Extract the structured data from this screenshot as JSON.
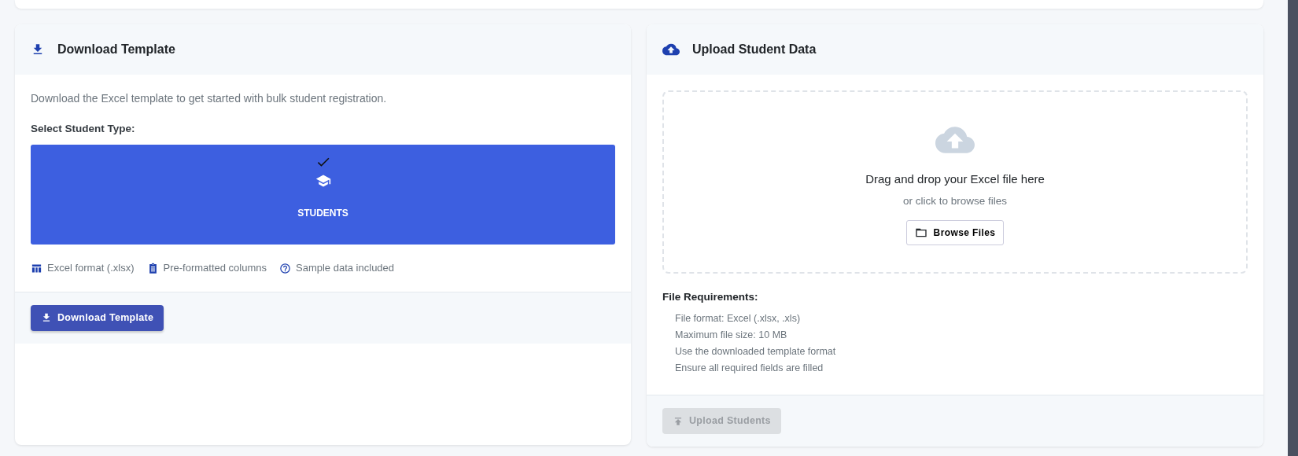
{
  "download_card": {
    "title": "Download Template",
    "description": "Download the Excel template to get started with bulk student registration.",
    "type_label": "Select Student Type:",
    "student_types": [
      {
        "label": "STUDENTS",
        "selected": true
      }
    ],
    "features": [
      {
        "kind": "table",
        "label": "Excel format (.xlsx)"
      },
      {
        "kind": "clipboard",
        "label": "Pre-formatted columns"
      },
      {
        "kind": "help",
        "label": "Sample data included"
      }
    ],
    "button": {
      "label": "Download Template",
      "disabled": false
    }
  },
  "upload_card": {
    "title": "Upload Student Data",
    "drop_title": "Drag and drop your Excel file here",
    "drop_hint": "or click to browse files",
    "browse_button": "Browse Files",
    "requirements_title": "File Requirements:",
    "requirements": [
      "File format: Excel (.xlsx, .xls)",
      "Maximum file size: 10 MB",
      "Use the downloaded template format",
      "Ensure all required fields are filled"
    ],
    "button": {
      "label": "Upload Students",
      "disabled": true
    }
  }
}
